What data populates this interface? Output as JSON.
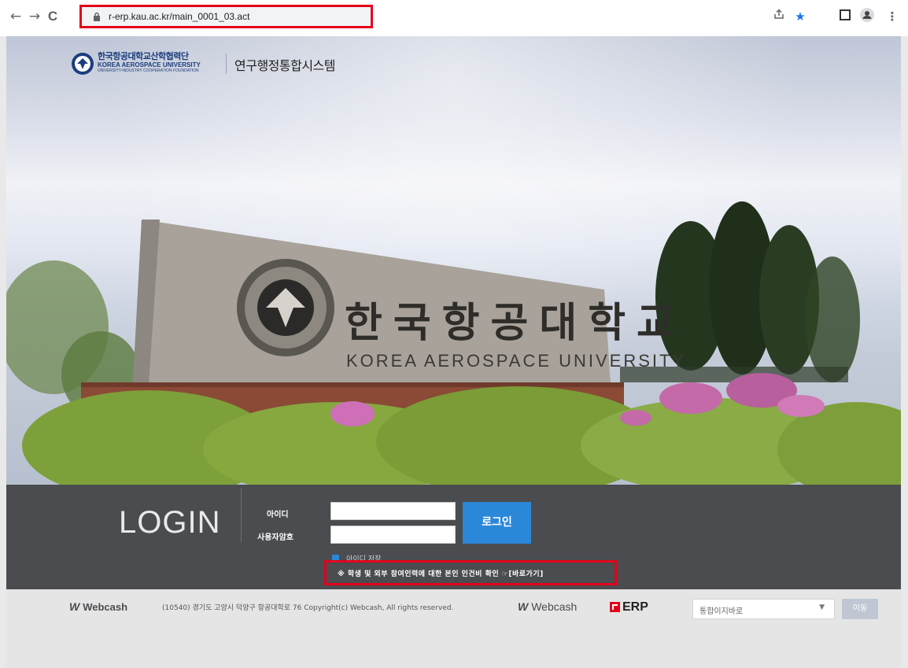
{
  "browser": {
    "back_glyph": "←",
    "forward_glyph": "→",
    "reload_glyph": "C",
    "url": "r-erp.kau.ac.kr/main_0001_03.act",
    "icons": [
      "share-icon",
      "star-icon",
      "sidebar-icon",
      "profile-icon",
      "menu-icon"
    ]
  },
  "header": {
    "org_name_ko": "한국항공대학교산학협력단",
    "org_name_en": "KOREA AEROSPACE UNIVERSITY",
    "org_name_sub": "UNIVERSITY-INDUSTRY COOPERATION FOUNDATION",
    "system_title": "연구행정통합시스템"
  },
  "login": {
    "title": "LOGIN",
    "id_label": "아이디",
    "password_label": "사용자암호",
    "id_value": "",
    "password_value": "",
    "submit_label": "로그인",
    "save_id_label": "아이디 저장",
    "save_id_checked": true,
    "notice": "※ 학생 및 외부 참여인력에 대한 본인 인건비 확인 ☞[바로가기]"
  },
  "footer": {
    "webcash_mark": "W",
    "webcash_label": "Webcash",
    "address": "(10540) 경기도 고양시 덕양구 항공대학로 76 Copyright(c) Webcash, All rights reserved.",
    "webcash2_label": "Webcash",
    "erp_label": "ERP",
    "goto_selected": "통합이지바로",
    "goto_button": "이동"
  },
  "colors": {
    "highlight_box": "#e3001b",
    "login_button": "#2b87d8",
    "login_bar": "#4a4c4f"
  }
}
